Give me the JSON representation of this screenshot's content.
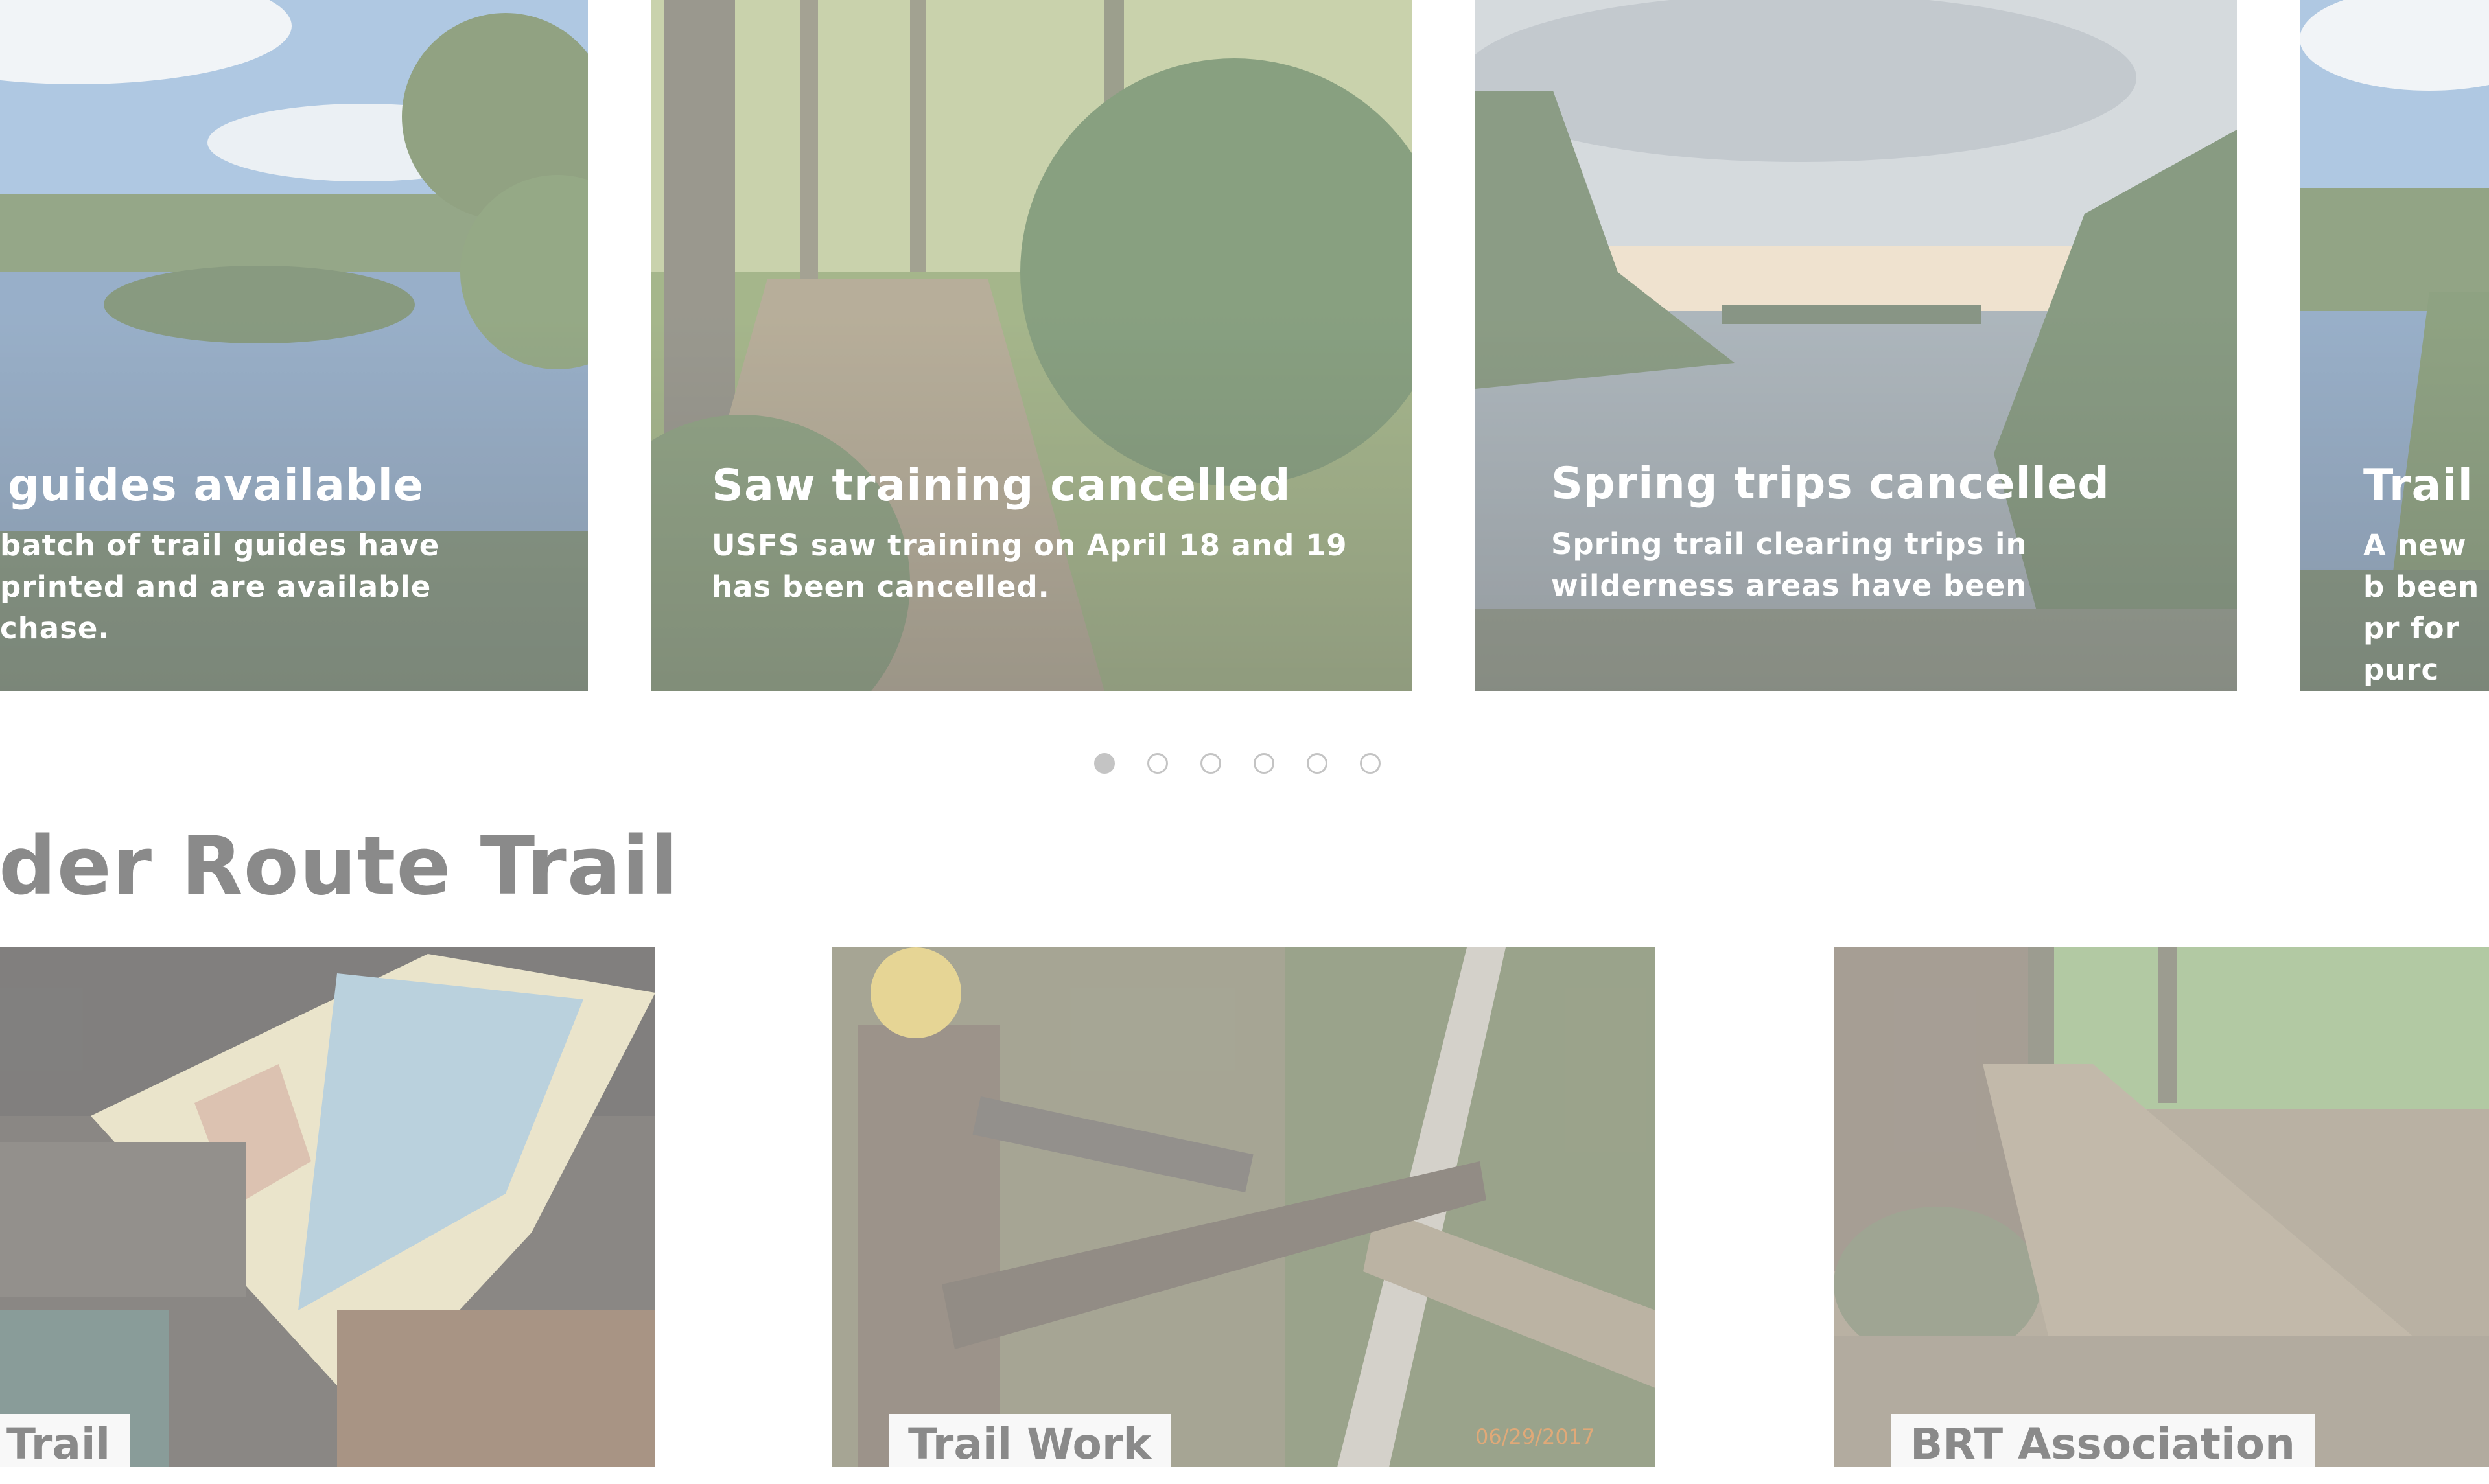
{
  "carousel": {
    "slides": [
      {
        "title": "guides available",
        "text": "batch of trail guides have printed and are available chase."
      },
      {
        "title": "Saw training cancelled",
        "text": "USFS saw training on April 18 and 19 has been cancelled."
      },
      {
        "title": "Spring trips cancelled",
        "text": "Spring trail clearing trips in wilderness areas have been"
      },
      {
        "title": "Trail g",
        "text": "A new b been pr for purc"
      }
    ],
    "dots_total": 6,
    "active_dot": 1
  },
  "section": {
    "title": "der Route Trail"
  },
  "cards": [
    {
      "label": "Trail"
    },
    {
      "label": "Trail Work",
      "photo_date": "06/29/2017"
    },
    {
      "label": "BRT Association"
    }
  ],
  "colors": {
    "heading": "#8a8a8a",
    "dot": "#c4c4c4",
    "label_bg": "#f8f8f8"
  }
}
